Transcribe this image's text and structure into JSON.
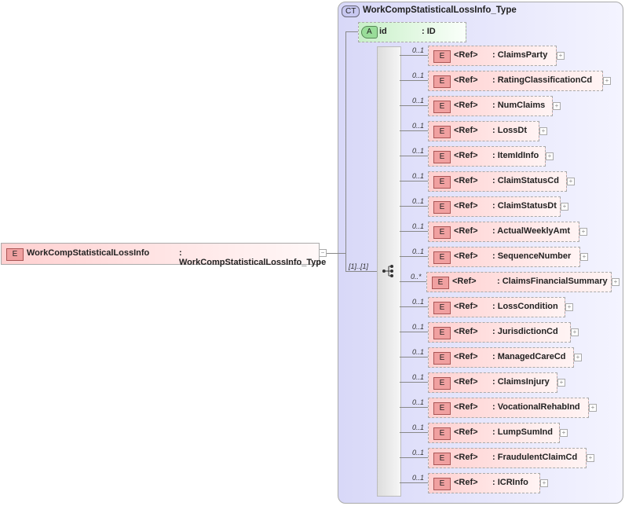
{
  "complex_type": {
    "badge": "CT",
    "name": "WorkCompStatisticalLossInfo_Type"
  },
  "attribute": {
    "badge": "A",
    "name": "id",
    "type": ": ID"
  },
  "main_element": {
    "badge": "E",
    "name": "WorkCompStatisticalLossInfo",
    "type": ": WorkCompStatisticalLossInfo_Type"
  },
  "sequence": {
    "cardinality": "[1]..[1]"
  },
  "children": [
    {
      "card": "0..1",
      "ref": "<Ref>",
      "name": ": ClaimsParty"
    },
    {
      "card": "0..1",
      "ref": "<Ref>",
      "name": ": RatingClassificationCd"
    },
    {
      "card": "0..1",
      "ref": "<Ref>",
      "name": ": NumClaims"
    },
    {
      "card": "0..1",
      "ref": "<Ref>",
      "name": ": LossDt"
    },
    {
      "card": "0..1",
      "ref": "<Ref>",
      "name": ": ItemIdInfo"
    },
    {
      "card": "0..1",
      "ref": "<Ref>",
      "name": ": ClaimStatusCd"
    },
    {
      "card": "0..1",
      "ref": "<Ref>",
      "name": ": ClaimStatusDt"
    },
    {
      "card": "0..1",
      "ref": "<Ref>",
      "name": ": ActualWeeklyAmt"
    },
    {
      "card": "0..1",
      "ref": "<Ref>",
      "name": ": SequenceNumber"
    },
    {
      "card": "0..*",
      "ref": "<Ref>",
      "name": ": ClaimsFinancialSummary"
    },
    {
      "card": "0..1",
      "ref": "<Ref>",
      "name": ": LossCondition"
    },
    {
      "card": "0..1",
      "ref": "<Ref>",
      "name": ": JurisdictionCd"
    },
    {
      "card": "0..1",
      "ref": "<Ref>",
      "name": ": ManagedCareCd"
    },
    {
      "card": "0..1",
      "ref": "<Ref>",
      "name": ": ClaimsInjury"
    },
    {
      "card": "0..1",
      "ref": "<Ref>",
      "name": ": VocationalRehabInd"
    },
    {
      "card": "0..1",
      "ref": "<Ref>",
      "name": ": LumpSumInd"
    },
    {
      "card": "0..1",
      "ref": "<Ref>",
      "name": ": FraudulentClaimCd"
    },
    {
      "card": "0..1",
      "ref": "<Ref>",
      "name": ": ICRInfo"
    }
  ],
  "element_badge": "E",
  "expand_glyph": "+",
  "collapse_glyph": "−"
}
